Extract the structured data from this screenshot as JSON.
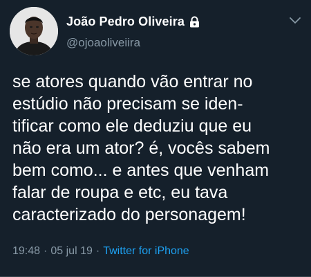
{
  "user": {
    "display_name": "João Pedro Oliveira",
    "handle": "@ojoaoliveiira",
    "protected_icon": "lock-icon",
    "avatar_icon": "avatar-portrait"
  },
  "menu": {
    "icon": "chevron-down-icon"
  },
  "tweet": {
    "text": "se atores quando vão entrar no\nestúdio não precisam se iden-\ntificar como ele deduziu que eu\nnão era um ator? é, vocês sabem\nbem como... e antes que venham\nfalar de roupa e etc, eu tava\ncaracterizado do personagem!"
  },
  "meta": {
    "time": "19:48",
    "separator": "·",
    "date": "05 jul 19",
    "source": "Twitter for iPhone"
  },
  "colors": {
    "background": "#15202b",
    "primary_text": "#ffffff",
    "secondary_text": "#8899a6",
    "link": "#1da1f2"
  }
}
